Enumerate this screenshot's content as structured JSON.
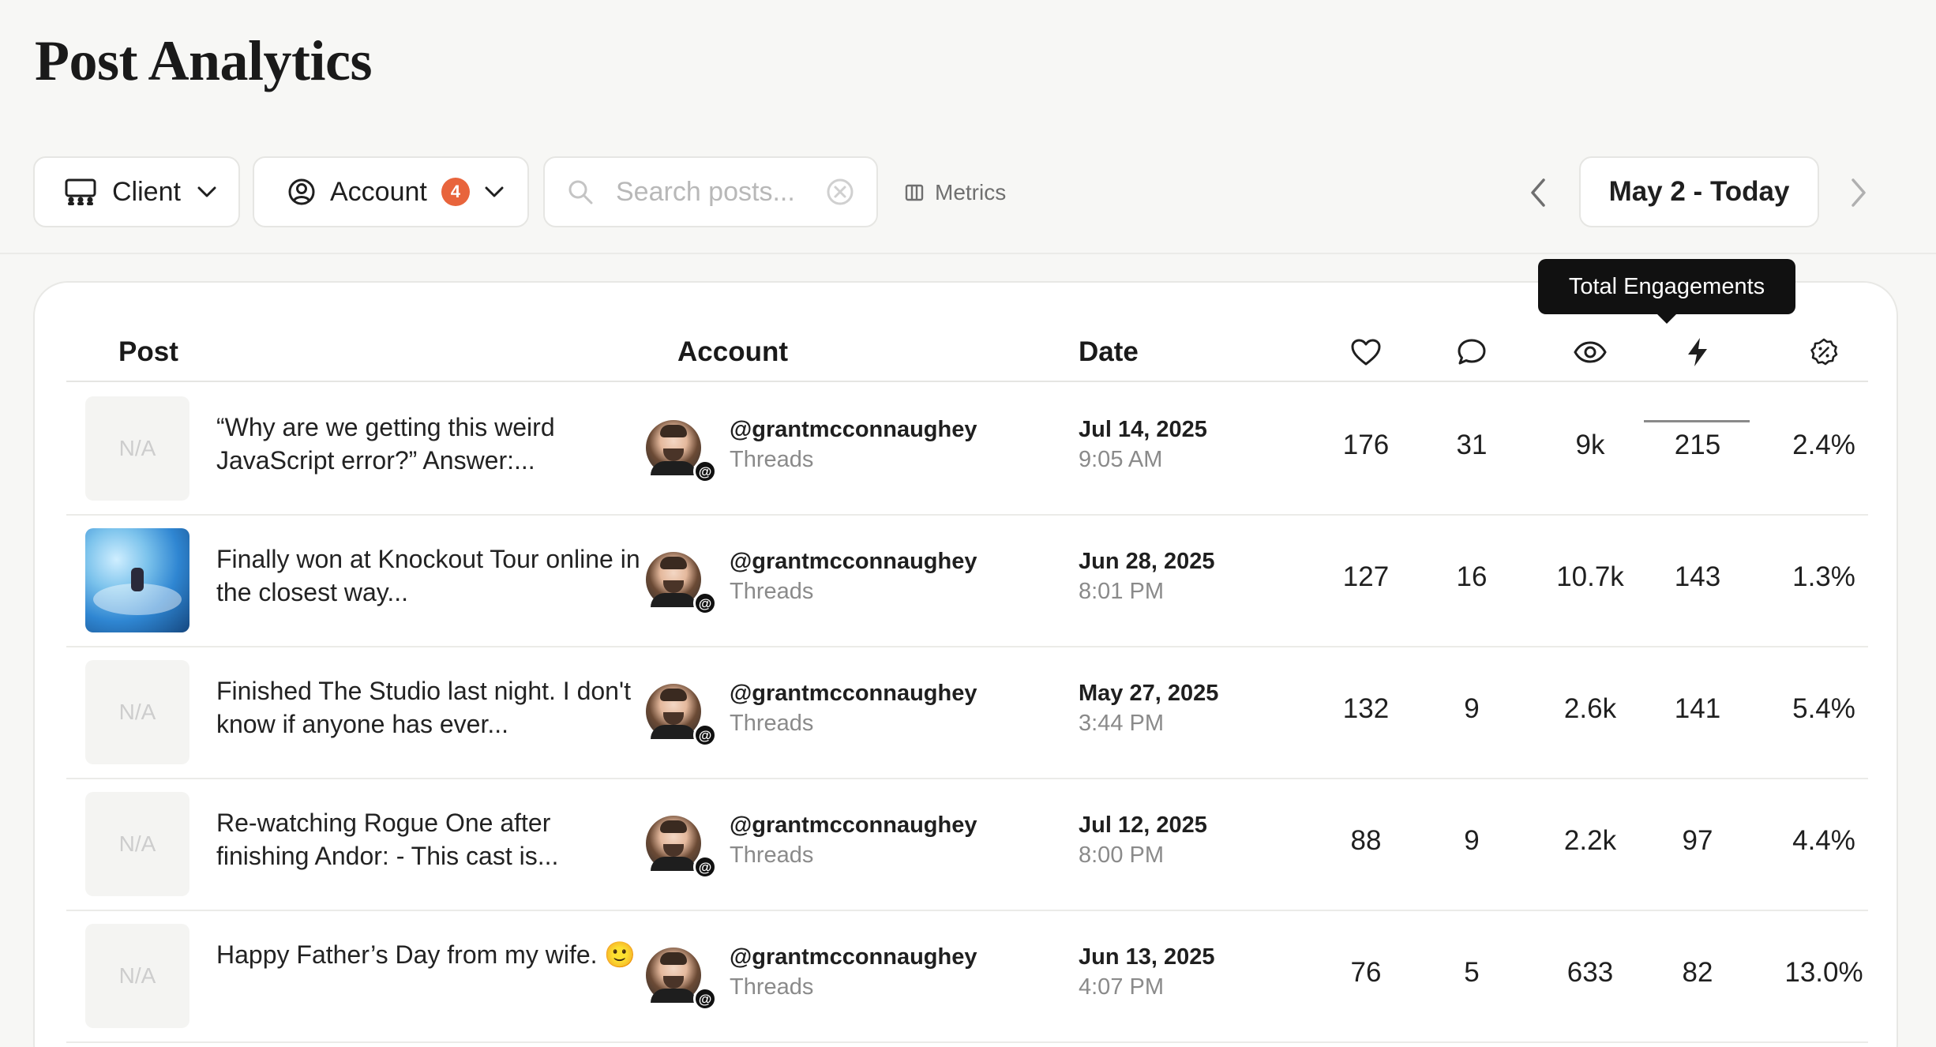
{
  "page": {
    "title": "Post Analytics"
  },
  "toolbar": {
    "client_label": "Client",
    "account_label": "Account",
    "account_badge": "4",
    "search_placeholder": "Search posts...",
    "metrics_label": "Metrics",
    "date_range": "May 2 - Today"
  },
  "tooltip": "Total Engagements",
  "table": {
    "headers": {
      "post": "Post",
      "account": "Account",
      "date": "Date"
    },
    "metric_icons": [
      "heart-icon",
      "comment-icon",
      "views-icon",
      "engagements-icon",
      "engagement-rate-icon"
    ],
    "rows": [
      {
        "thumb": "N/A",
        "text": "“Why are we getting this weird JavaScript error?” Answer:...",
        "handle": "@grantmcconnaughey",
        "platform": "Threads",
        "date": "Jul 14, 2025",
        "time": "9:05 AM",
        "likes": "176",
        "comments": "31",
        "views": "9k",
        "engagements": "215",
        "rate": "2.4%"
      },
      {
        "thumb": "",
        "text": "Finally won at Knockout Tour online in the closest way...",
        "handle": "@grantmcconnaughey",
        "platform": "Threads",
        "date": "Jun 28, 2025",
        "time": "8:01 PM",
        "likes": "127",
        "comments": "16",
        "views": "10.7k",
        "engagements": "143",
        "rate": "1.3%"
      },
      {
        "thumb": "N/A",
        "text": "Finished The Studio last night. I don't know if anyone has ever...",
        "handle": "@grantmcconnaughey",
        "platform": "Threads",
        "date": "May 27, 2025",
        "time": "3:44 PM",
        "likes": "132",
        "comments": "9",
        "views": "2.6k",
        "engagements": "141",
        "rate": "5.4%"
      },
      {
        "thumb": "N/A",
        "text": "Re-watching Rogue One after finishing Andor: - This cast is...",
        "handle": "@grantmcconnaughey",
        "platform": "Threads",
        "date": "Jul 12, 2025",
        "time": "8:00 PM",
        "likes": "88",
        "comments": "9",
        "views": "2.2k",
        "engagements": "97",
        "rate": "4.4%"
      },
      {
        "thumb": "N/A",
        "text": "Happy Father’s Day from my wife. 🙂",
        "handle": "@grantmcconnaughey",
        "platform": "Threads",
        "date": "Jun 13, 2025",
        "time": "4:07 PM",
        "likes": "76",
        "comments": "5",
        "views": "633",
        "engagements": "82",
        "rate": "13.0%"
      }
    ]
  },
  "colors": {
    "badge": "#e8643c",
    "accent_dark": "#111111"
  }
}
